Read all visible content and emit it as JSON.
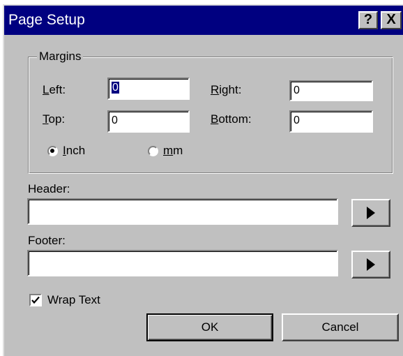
{
  "window": {
    "title": "Page Setup",
    "help_label": "?",
    "close_label": "X"
  },
  "margins": {
    "group_label": "Margins",
    "left_label": "Left:",
    "left_key": "L",
    "left_rest": "eft:",
    "left_value": "0",
    "right_key": "R",
    "right_rest": "ight:",
    "right_value": "0",
    "top_key": "T",
    "top_rest": "op:",
    "top_value": "0",
    "bottom_key": "B",
    "bottom_rest": "ottom:",
    "bottom_value": "0",
    "unit_inch_key": "I",
    "unit_inch_rest": "nch",
    "unit_mm_key": "m",
    "unit_mm_rest": "m",
    "selected_unit": "Inch"
  },
  "header": {
    "label": "Header:",
    "value": ""
  },
  "footer": {
    "label": "Footer:",
    "value": ""
  },
  "wrap_text": {
    "label": "Wrap Text",
    "checked": true
  },
  "buttons": {
    "ok_label": "OK",
    "cancel_label": "Cancel"
  },
  "colors": {
    "titlebar": "#000080",
    "face": "#c0c0c0",
    "field": "#ffffff"
  }
}
